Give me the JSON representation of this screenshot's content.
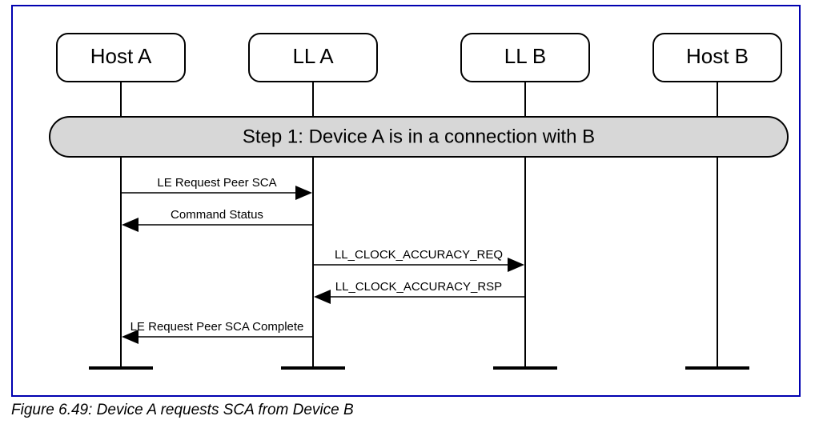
{
  "figure_caption": "Figure 6.49:  Device A requests SCA from Device B",
  "lifelines": {
    "host_a": "Host A",
    "ll_a": "LL A",
    "ll_b": "LL B",
    "host_b": "Host B"
  },
  "step_banner": "Step 1: Device A is in a connection with B",
  "messages": {
    "m1": "LE Request Peer SCA",
    "m2": "Command Status",
    "m3": "LL_CLOCK_ACCURACY_REQ",
    "m4": "LL_CLOCK_ACCURACY_RSP",
    "m5": "LE Request Peer SCA Complete"
  }
}
